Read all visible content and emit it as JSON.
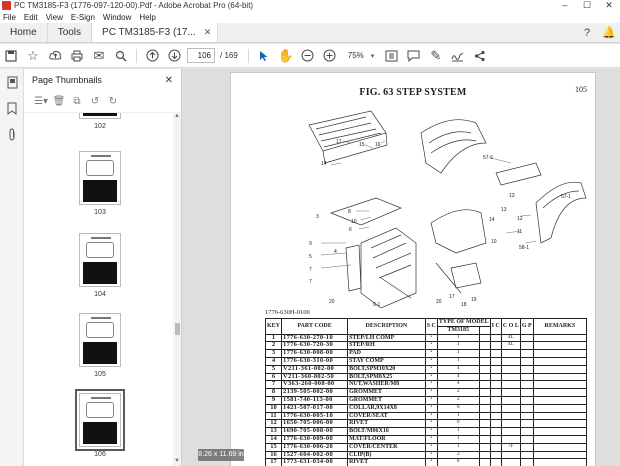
{
  "window": {
    "title": "PC TM3185-F3 (1776-097-120-00).Pdf - Adobe Acrobat Pro (64-bit)",
    "controls": [
      "–",
      "☐",
      "✕"
    ]
  },
  "menu": [
    "File",
    "Edit",
    "View",
    "E-Sign",
    "Window",
    "Help"
  ],
  "tabs": {
    "home": "Home",
    "tools": "Tools",
    "document": "PC TM3185-F3 (17..."
  },
  "toolbar": {
    "current_page": "106",
    "page_total": "/  169",
    "zoom": "75%"
  },
  "thumbnails": {
    "title": "Page Thumbnails",
    "items": [
      {
        "label": "102"
      },
      {
        "label": "103"
      },
      {
        "label": "104"
      },
      {
        "label": "105"
      },
      {
        "label": "106"
      }
    ]
  },
  "page": {
    "number": "105",
    "title": "FIG. 63  STEP SYSTEM",
    "doc_ref": "1776-630H-0100",
    "headers": {
      "key": "KEY",
      "part_code": "PART CODE",
      "description": "DESCRIPTION",
      "s_col": "S C",
      "type_of_model": "TYPE OF MODEL",
      "model": "TM3185",
      "i_col": "I C",
      "c_col": "C O L",
      "g_col": "G P",
      "remarks": "REMARKS"
    },
    "rows": [
      {
        "key": "1",
        "code": "1776-630-270-10",
        "desc": "STEP/LH          COMP",
        "s": "•",
        "qty": "1",
        "c": "4L"
      },
      {
        "key": "2",
        "code": "1776-630-720-30",
        "desc": "STEP/RH",
        "s": "•",
        "qty": "1",
        "c": "4L"
      },
      {
        "key": "3",
        "code": "1776-630-008-00",
        "desc": "PAD",
        "s": "•",
        "qty": "1",
        "c": ""
      },
      {
        "key": "4",
        "code": "1776-630-310-00",
        "desc": "STAY              COMP",
        "s": "•",
        "qty": "1",
        "c": ""
      },
      {
        "key": "5",
        "code": "V211-361-002-00",
        "desc": "BOLT,SPM10X20",
        "s": "•",
        "qty": "4",
        "c": ""
      },
      {
        "key": "6",
        "code": "V211-360-802-50",
        "desc": "BOLT,SPM8X25",
        "s": "•",
        "qty": "4",
        "c": ""
      },
      {
        "key": "7",
        "code": "V363-260-008-00",
        "desc": "NUT,WASHER/M8",
        "s": "•",
        "qty": "4",
        "c": ""
      },
      {
        "key": "8",
        "code": "2139-505-002-00",
        "desc": "GROMMET",
        "s": "•",
        "qty": "2",
        "c": ""
      },
      {
        "key": "9",
        "code": "1581-740-113-00",
        "desc": "GROMMET",
        "s": "•",
        "qty": "2",
        "c": ""
      },
      {
        "key": "10",
        "code": "1421-507-017-00",
        "desc": "COLLAR,9X14X8",
        "s": "•",
        "qty": "6",
        "c": ""
      },
      {
        "key": "11",
        "code": "1776-630-005-10",
        "desc": "COVER/SEAT",
        "s": "•",
        "qty": "1",
        "c": ""
      },
      {
        "key": "12",
        "code": "1650-705-006-00",
        "desc": "RIVET",
        "s": "•",
        "qty": "6",
        "c": ""
      },
      {
        "key": "13",
        "code": "1690-705-008-00",
        "desc": "BOLT/M06X16",
        "s": "•",
        "qty": "1",
        "c": ""
      },
      {
        "key": "14",
        "code": "1776-630-009-00",
        "desc": "MAT/FLOOR",
        "s": "•",
        "qty": "1",
        "c": ""
      },
      {
        "key": "15",
        "code": "1776-630-006-20",
        "desc": "COVER/CENTER",
        "s": "•",
        "qty": "1",
        "c": "7F"
      },
      {
        "key": "16",
        "code": "1527-604-002-00",
        "desc": "CLIP(B)",
        "s": "•",
        "qty": "2",
        "c": ""
      },
      {
        "key": "17",
        "code": "1773-631-034-00",
        "desc": "RIVET",
        "s": "•",
        "qty": "8",
        "c": ""
      }
    ]
  },
  "status": {
    "page_size": "8.26 x 11.69 in"
  },
  "diagram_labels": [
    "17",
    "15",
    "16",
    "14",
    "57-6",
    "13",
    "57-1",
    "12",
    "11",
    "8",
    "10",
    "9",
    "4",
    "5",
    "7",
    "3",
    "6",
    "58-1",
    "20",
    "9-1",
    "17",
    "18",
    "19",
    "20",
    "13",
    "14",
    "7",
    "10"
  ]
}
